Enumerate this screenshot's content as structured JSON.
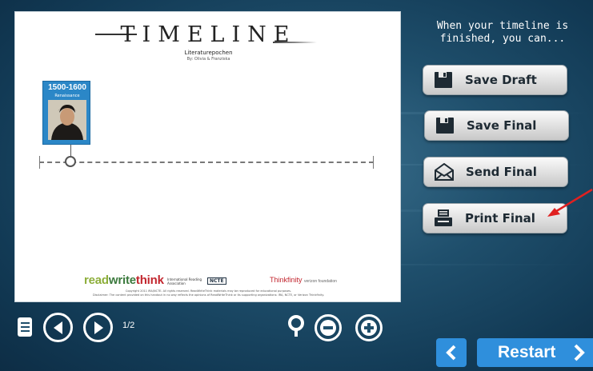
{
  "colors": {
    "accent_blue": "#2f8fdc",
    "card_blue": "#2b87c7",
    "annotation_red": "#e02020"
  },
  "document": {
    "title": "TIMELINE",
    "subtitle": "Literaturepochen",
    "byline": "By: Olivia & Franziska",
    "event_card": {
      "date": "1500-1600",
      "label": "Renaissance",
      "image_icon": "portrait-image"
    },
    "footer": {
      "logo_read": "read",
      "logo_write": "write",
      "logo_think": "think",
      "ira_text": "International Reading Association",
      "ncte": "NCTE",
      "thinkfinity": "Thinkfinity",
      "thinkfinity_sub": "verizon foundation",
      "copyright": "Copyright 2011 IRA/NCTE. All rights reserved. ReadWriteThink materials may be reproduced for educational purposes.",
      "disclaimer": "Disclaimer: The content provided on this handout in no way reflects the opinions of ReadWriteThink or its supporting organizations: IRA, NCTE, or Verizon Thinkfinity."
    }
  },
  "panel": {
    "prompt": "When your timeline is finished, you can...",
    "buttons": [
      {
        "label": "Save Draft",
        "icon": "floppy-disk-icon"
      },
      {
        "label": "Save Final",
        "icon": "floppy-disk-icon"
      },
      {
        "label": "Send Final",
        "icon": "envelope-icon"
      },
      {
        "label": "Print Final",
        "icon": "printer-icon"
      }
    ]
  },
  "controls": {
    "page_indicator": "1/2",
    "menu_icon": "menu-icon",
    "prev_icon": "prev-page-icon",
    "next_icon": "next-page-icon",
    "zoom_icon": "magnifier-icon",
    "zoom_out_icon": "zoom-out-icon",
    "zoom_in_icon": "zoom-in-icon"
  },
  "footer_nav": {
    "back_icon": "chevron-left-icon",
    "restart_label": "Restart",
    "forward_icon": "chevron-right-icon"
  }
}
